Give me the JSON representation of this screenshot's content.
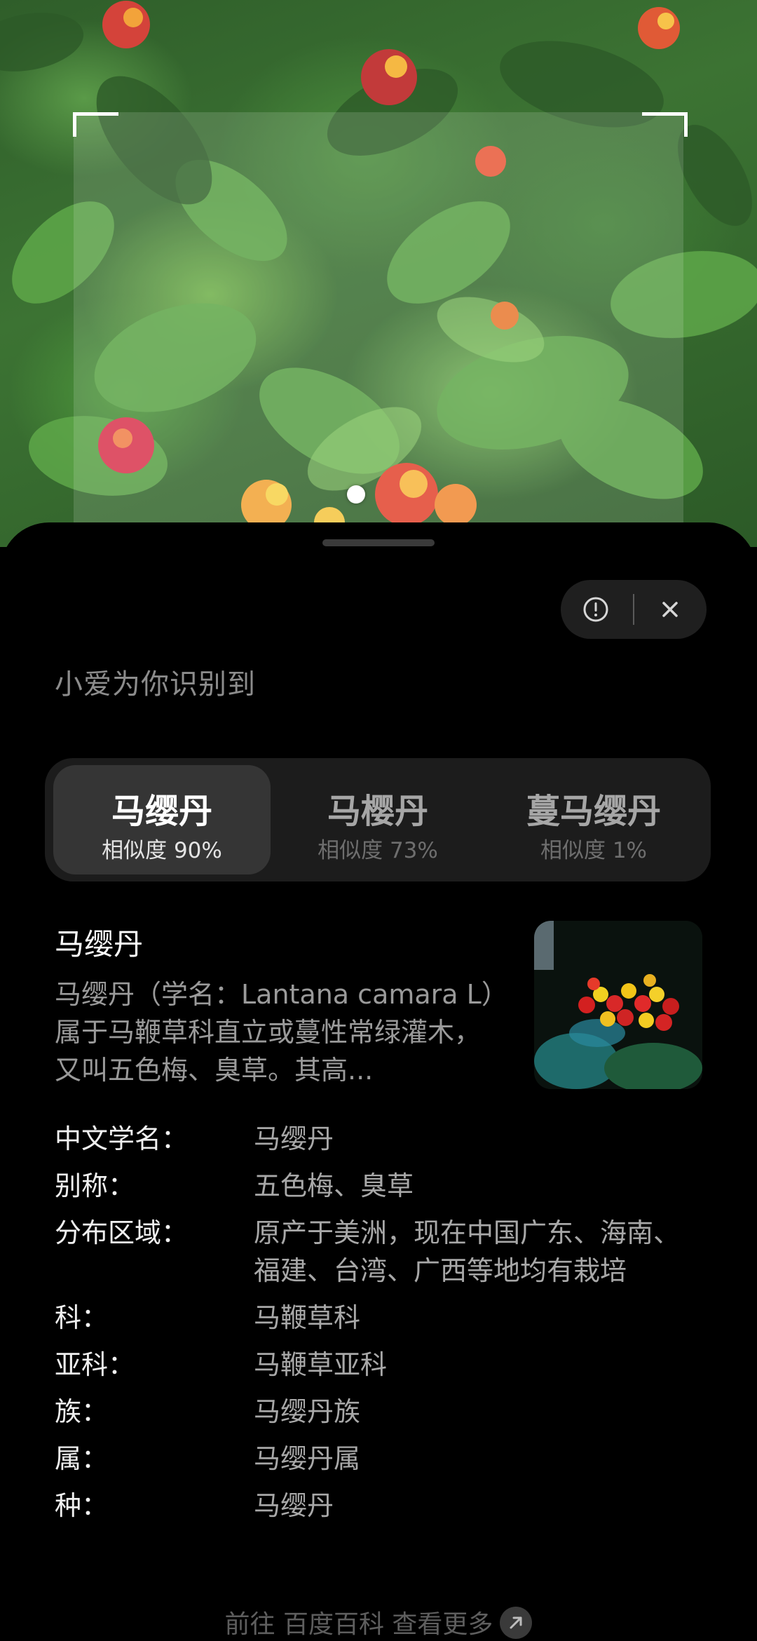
{
  "camera": {
    "icons": [
      "scan-frame-corner",
      "focus-dot"
    ]
  },
  "sheet": {
    "heading": "小爱为你识别到",
    "icons": {
      "feedback": "exclamation-circle-icon",
      "close": "close-icon"
    }
  },
  "results": [
    {
      "name": "马缨丹",
      "score": "相似度 90%"
    },
    {
      "name": "马樱丹",
      "score": "相似度 73%"
    },
    {
      "name": "蔓马缨丹",
      "score": "相似度 1%"
    }
  ],
  "summary": {
    "title": "马缨丹",
    "text": "马缨丹（学名：Lantana camara L）属于马鞭草科直立或蔓性常绿灌木，又叫五色梅、臭草。其高..."
  },
  "details": [
    {
      "label": "中文学名：",
      "value": "马缨丹"
    },
    {
      "label": "别称：",
      "value": "五色梅、臭草"
    },
    {
      "label": "分布区域：",
      "value": "原产于美洲，现在中国广东、海南、福建、台湾、广西等地均有栽培"
    },
    {
      "label": "科：",
      "value": "马鞭草科"
    },
    {
      "label": "亚科：",
      "value": "马鞭草亚科"
    },
    {
      "label": "族：",
      "value": "马缨丹族"
    },
    {
      "label": "属：",
      "value": "马缨丹属"
    },
    {
      "label": "种：",
      "value": "马缨丹"
    }
  ],
  "footer": {
    "link_text": "前往 百度百科 查看更多",
    "icon": "arrow-up-right-icon"
  },
  "colors": {
    "sheet_background": "#000000",
    "tab_container": "#1c1c1c",
    "tab_active": "#353535",
    "muted_text": "#8c8c8c"
  }
}
